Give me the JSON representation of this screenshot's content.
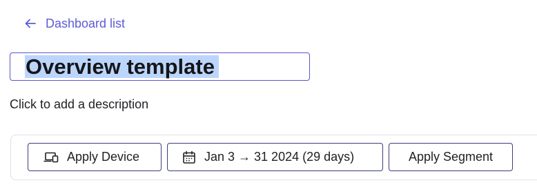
{
  "nav": {
    "back_label": "Dashboard list",
    "back_icon": "arrow-left-icon"
  },
  "dashboard": {
    "title": "Overview template",
    "description_placeholder": "Click to add a description"
  },
  "filters": {
    "device": {
      "label": "Apply Device",
      "icon": "devices-icon"
    },
    "date_range": {
      "label": "Jan 3 → 31 2024 (29 days)",
      "icon": "calendar-icon"
    },
    "segment": {
      "label": "Apply Segment"
    }
  },
  "colors": {
    "accent": "#5b5bd6",
    "selection": "#bcd6fb",
    "button_border": "#3c3b7a"
  }
}
